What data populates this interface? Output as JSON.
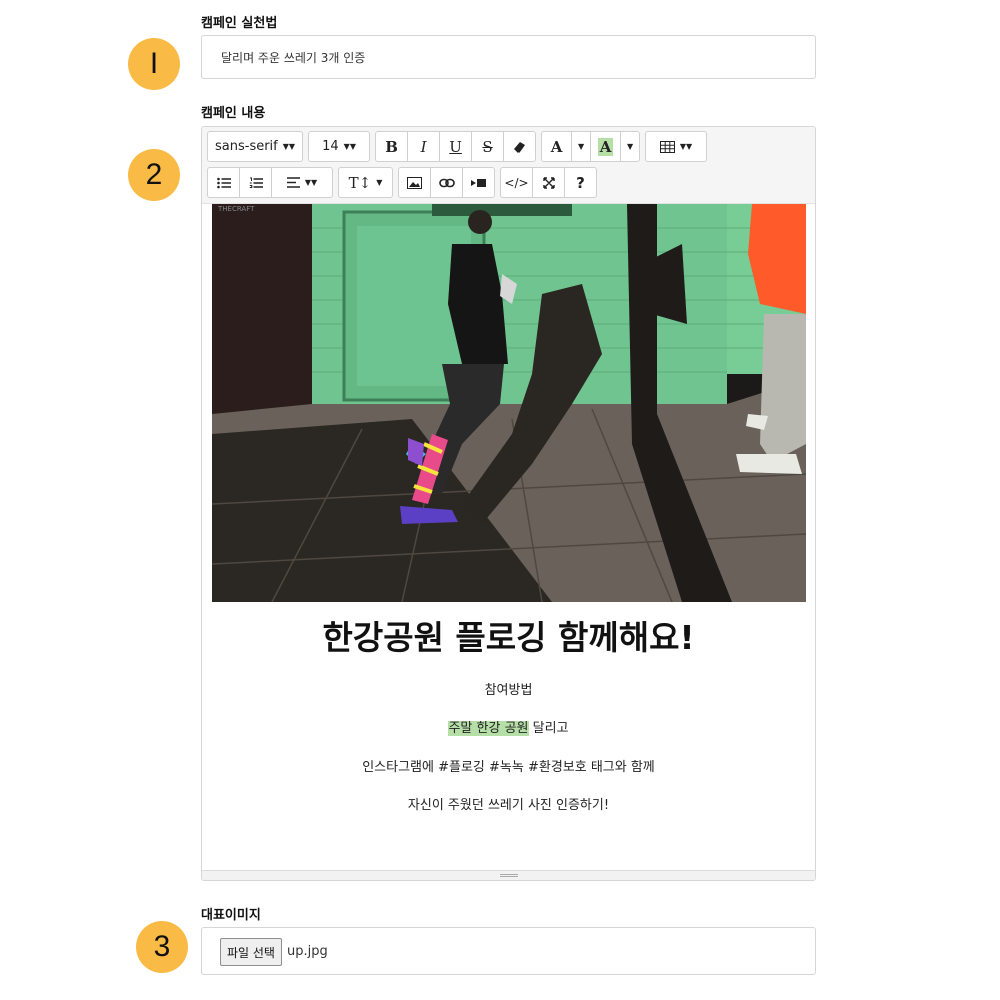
{
  "badges": [
    "I",
    "2",
    "3"
  ],
  "campaign_method": {
    "label": "캠페인 실천법",
    "value": "달리며 주운 쓰레기 3개 인증"
  },
  "campaign_content": {
    "label": "캠페인 내용",
    "toolbar": {
      "font_family": "sans-serif",
      "font_size": "14",
      "bold": "B",
      "italic": "I",
      "underline": "U",
      "strikethrough": "S",
      "font_color": "A",
      "highlight_color": "A",
      "line_height": "T↕",
      "code_view": "</>",
      "help": "?"
    },
    "image_watermark": "THECRAFT",
    "heading": "한강공원 플로깅 함께해요!",
    "paragraphs": {
      "p1": "참여방법",
      "p2_highlight": "주말 한강 공원",
      "p2_rest": " 달리고",
      "p3": "인스타그램에 #플로깅 #녹녹 #환경보호 태그와 함께",
      "p4": "자신이 주웠던 쓰레기 사진 인증하기!"
    },
    "highlight_color": "#b6dfa8"
  },
  "representative_image": {
    "label": "대표이미지",
    "button": "파일 선택",
    "filename": "up.jpg"
  },
  "colors": {
    "badge": "#f9bb45",
    "wall": "#6fc48f",
    "jacket": "#ff5a2a"
  }
}
